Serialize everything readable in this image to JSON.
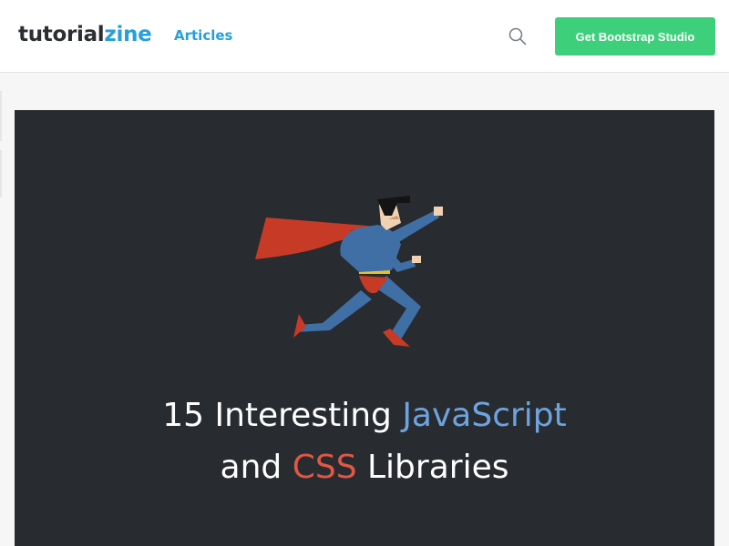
{
  "header": {
    "logo": {
      "part1": "tutorial",
      "part2": "zine"
    },
    "nav": {
      "articles_label": "Articles"
    },
    "search_icon": "search-icon",
    "cta_label": "Get Bootstrap Studio"
  },
  "hero": {
    "illustration": "superhero-illustration",
    "title": {
      "line1_prefix": "15 Interesting ",
      "line1_highlight": "JavaScript",
      "line2_prefix": "and ",
      "line2_highlight": "CSS",
      "line2_suffix": " Libraries"
    }
  },
  "colors": {
    "brand_blue": "#2a9fd6",
    "cta_green": "#3ecf7b",
    "hero_bg": "#282b30",
    "javascript_accent": "#6da4e0",
    "css_accent": "#e25644"
  }
}
